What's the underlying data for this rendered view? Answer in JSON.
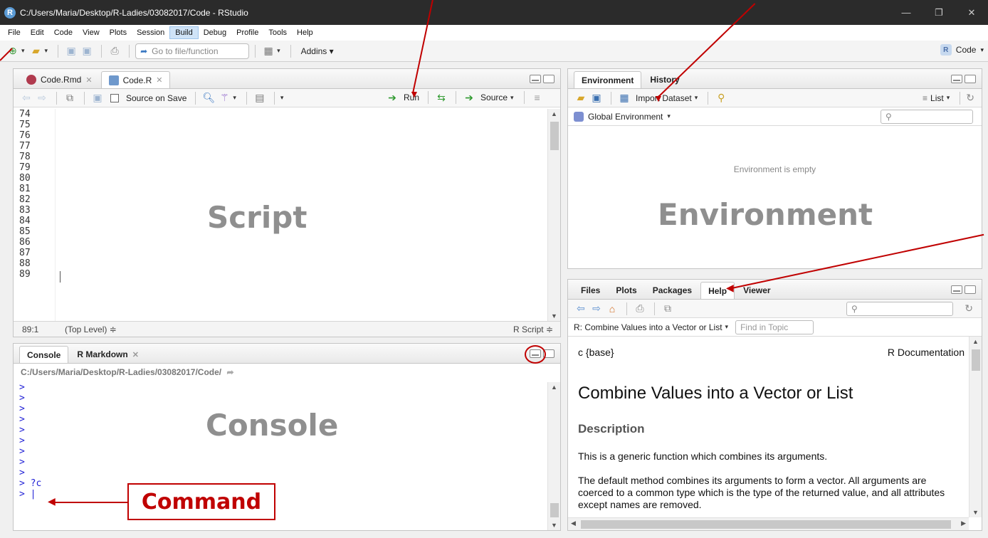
{
  "window": {
    "title": "C:/Users/Maria/Desktop/R-Ladies/03082017/Code - RStudio"
  },
  "menu": [
    "File",
    "Edit",
    "Code",
    "View",
    "Plots",
    "Session",
    "Build",
    "Debug",
    "Profile",
    "Tools",
    "Help"
  ],
  "toolbar": {
    "goto_placeholder": "Go to file/function",
    "addins": "Addins",
    "project": "Code"
  },
  "source_pane": {
    "tabs": [
      "Code.Rmd",
      "Code.R"
    ],
    "source_on_save": "Source on Save",
    "run": "Run",
    "source": "Source",
    "line_numbers": [
      "74",
      "75",
      "76",
      "77",
      "78",
      "79",
      "80",
      "81",
      "82",
      "83",
      "84",
      "85",
      "86",
      "87",
      "88",
      "89"
    ],
    "status_pos": "89:1",
    "status_scope": "(Top Level) ≑",
    "status_type": "R Script ≑",
    "label": "Script"
  },
  "console_pane": {
    "tabs": [
      "Console",
      "R Markdown"
    ],
    "path": "C:/Users/Maria/Desktop/R-Ladies/03082017/Code/",
    "prompts": [
      ">",
      ">",
      ">",
      ">",
      ">",
      ">",
      ">",
      ">",
      ">",
      ">"
    ],
    "command": "> ?c",
    "cursor": "> |",
    "label": "Console",
    "annotation": "Command"
  },
  "env_pane": {
    "tabs": [
      "Environment",
      "History"
    ],
    "import": "Import Dataset",
    "list": "List",
    "scope": "Global Environment",
    "empty": "Environment is empty",
    "label": "Environment"
  },
  "help_pane": {
    "tabs": [
      "Files",
      "Plots",
      "Packages",
      "Help",
      "Viewer"
    ],
    "topic": "R: Combine Values into a Vector or List",
    "find_placeholder": "Find in Topic",
    "pkg": "c {base}",
    "doc": "R Documentation",
    "heading": "Combine Values into a Vector or List",
    "section": "Description",
    "para1": "This is a generic function which combines its arguments.",
    "para2": "The default method combines its arguments to form a vector. All arguments are coerced to a common type which is the type of the returned value, and all attributes except names are removed."
  },
  "colors": {
    "annotation": "#c00000",
    "prompt": "#2323d6",
    "watermark": "#8f8f8f"
  }
}
